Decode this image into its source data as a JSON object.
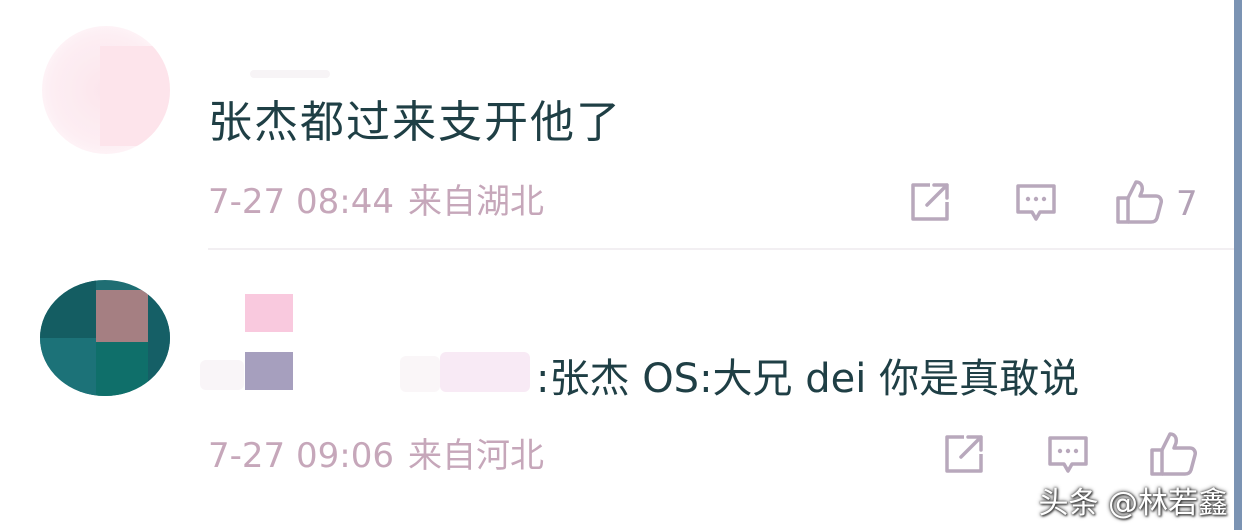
{
  "comments": [
    {
      "text": "张杰都过来支开他了",
      "date": "7-27 08:44",
      "location": "来自湖北",
      "like_count": "7"
    },
    {
      "text": ":张杰 OS:大兄 dei 你是真敢说",
      "date": "7-27 09:06",
      "location": "来自河北",
      "like_count": ""
    }
  ],
  "icons": {
    "share": "share-icon",
    "reply": "reply-icon",
    "like": "thumbs-up-icon"
  },
  "colors": {
    "text": "#1f3f45",
    "meta": "#c6a7ba",
    "icon": "#b8a8bc",
    "edge": "#7b93b3"
  },
  "watermark": "头条 @林若鑫"
}
